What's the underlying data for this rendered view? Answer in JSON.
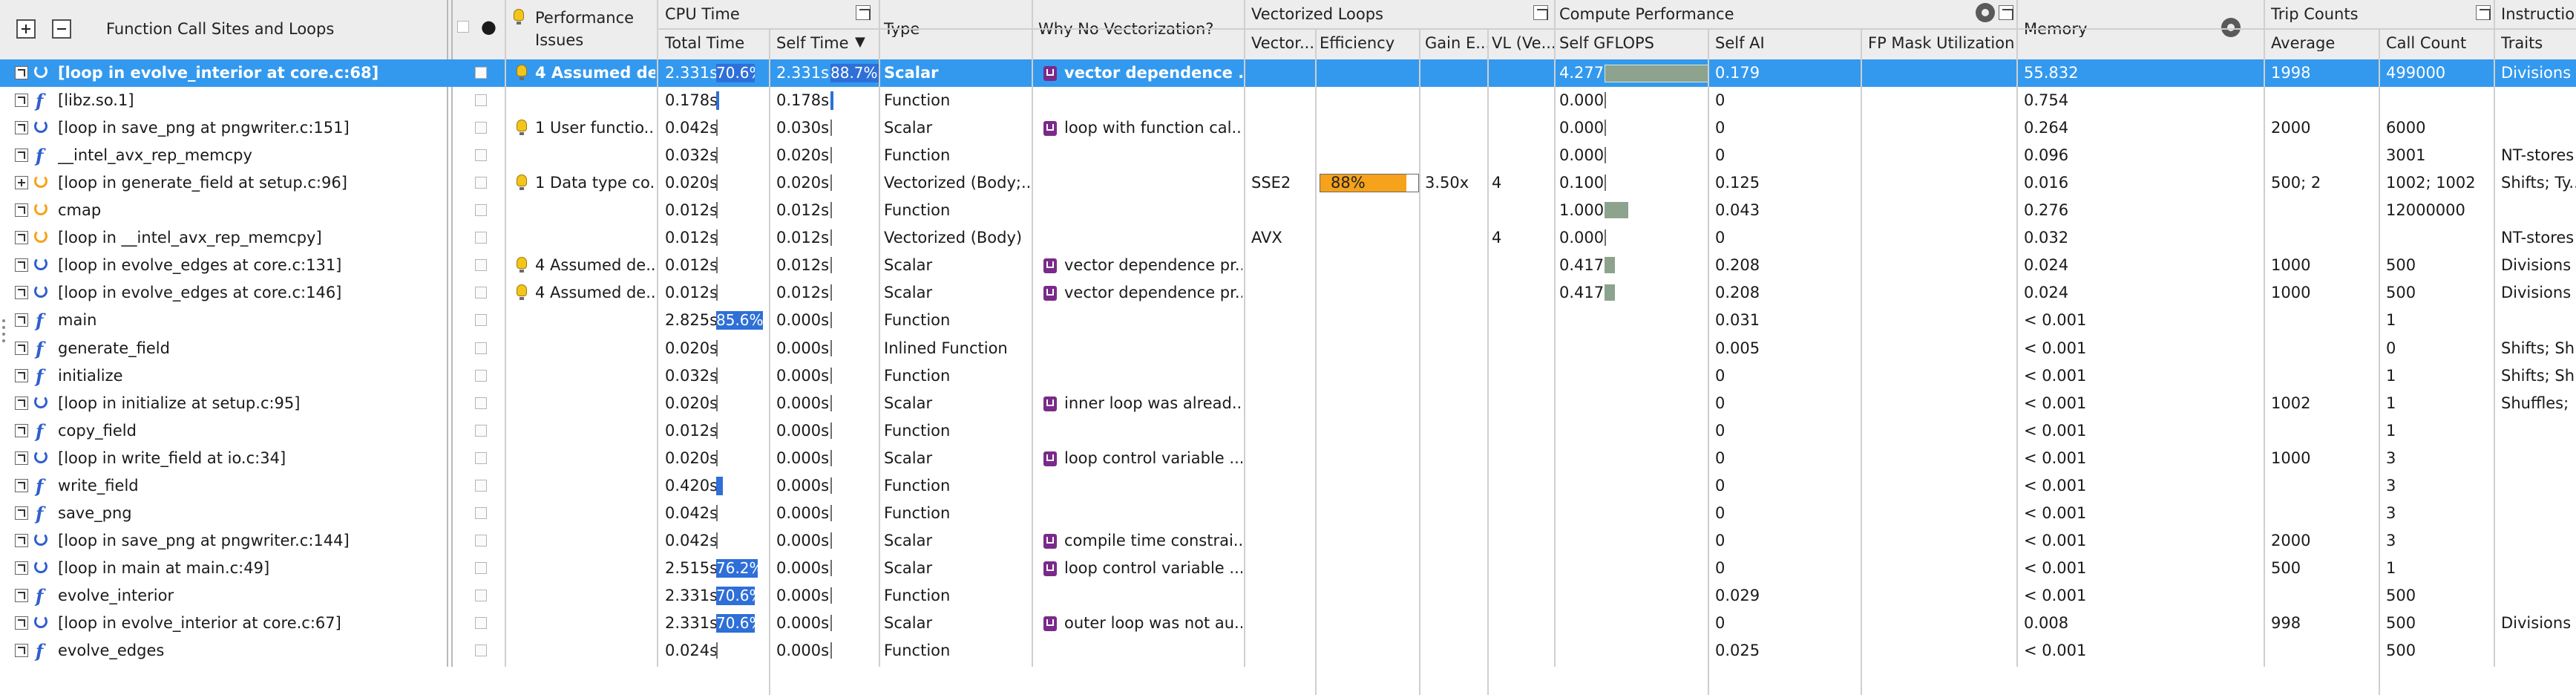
{
  "header": {
    "expand_all": "+",
    "collapse_all": "−",
    "function_col": "Function Call Sites and Loops",
    "perf_issues_1": "Performance",
    "perf_issues_2": "Issues",
    "cpu_time": "CPU Time",
    "total_time": "Total Time",
    "self_time": "Self Time",
    "type": "Type",
    "why_no_vec": "Why No Vectorization?",
    "vectorized_loops": "Vectorized Loops",
    "vectorized_col": "Vector...",
    "efficiency": "Efficiency",
    "gain": "Gain E...",
    "vl": "VL (Ve...",
    "compute_perf": "Compute Performance",
    "self_gflops": "Self GFLOPS",
    "self_ai": "Self AI",
    "fp_mask": "FP Mask Utilization",
    "memory": "Memory",
    "trip_counts": "Trip Counts",
    "average": "Average",
    "call_count": "Call Count",
    "instructions": "Instructio",
    "traits": "Traits",
    "sort_indicator": "▼",
    "expand_icon": "»"
  },
  "rows": [
    {
      "name": "[loop in evolve_interior at core.c:68]",
      "icon": "loop-icon",
      "issue": "4 Assumed de...",
      "total": "2.331s",
      "total_pct": 70.6,
      "total_label": "70.6%",
      "self": "2.331s",
      "self_pct": 88.7,
      "self_label": "88.7%",
      "type": "Scalar",
      "why": "vector dependence ...",
      "vec": "",
      "eff": "",
      "gain": "",
      "vl": "",
      "gflops": "4.277",
      "gflops_frac": 1.0,
      "ai": "0.179",
      "memory": "55.832",
      "avg": "1998",
      "calls": "499000",
      "traits": "Divisions",
      "selected": true
    },
    {
      "name": "[libz.so.1]",
      "icon": "function-icon",
      "issue": "",
      "total": "0.178s",
      "total_pct": 3,
      "self": "0.178s",
      "self_pct": 3,
      "type": "Function",
      "why": "",
      "gflops": "0.000",
      "ai": "0",
      "memory": "0.754",
      "avg": "",
      "calls": "",
      "traits": ""
    },
    {
      "name": "[loop in save_png at pngwriter.c:151]",
      "icon": "loop-icon",
      "issue": "1 User functio...",
      "total": "0.042s",
      "self": "0.030s",
      "type": "Scalar",
      "why": "loop with function cal...",
      "gflops": "0.000",
      "ai": "0",
      "memory": "0.264",
      "avg": "2000",
      "calls": "6000",
      "traits": ""
    },
    {
      "name": "__intel_avx_rep_memcpy",
      "icon": "function-icon",
      "issue": "",
      "total": "0.032s",
      "self": "0.020s",
      "type": "Function",
      "why": "",
      "gflops": "0.000",
      "ai": "0",
      "memory": "0.096",
      "avg": "",
      "calls": "3001",
      "traits": "NT-stores"
    },
    {
      "name": "[loop in generate_field at setup.c:96]",
      "icon": "loop-orange-icon",
      "issue": "1 Data type co...",
      "total": "0.020s",
      "self": "0.020s",
      "type": "Vectorized (Body;...",
      "why": "",
      "vec": "SSE2",
      "eff": "88%",
      "eff_frac": 0.88,
      "gain": "3.50x",
      "vl": "4",
      "gflops": "0.100",
      "ai": "0.125",
      "memory": "0.016",
      "avg": "500; 2",
      "calls": "1002; 1002",
      "traits": "Shifts; Ty..."
    },
    {
      "name": "cmap",
      "icon": "loop-orange-icon",
      "issue": "",
      "total": "0.012s",
      "self": "0.012s",
      "type": "Function",
      "why": "",
      "gflops": "1.000",
      "gflops_frac": 0.23,
      "ai": "0.043",
      "memory": "0.276",
      "avg": "",
      "calls": "12000000",
      "traits": ""
    },
    {
      "name": "[loop in __intel_avx_rep_memcpy]",
      "icon": "loop-orange-icon",
      "issue": "",
      "total": "0.012s",
      "self": "0.012s",
      "type": "Vectorized (Body)",
      "why": "",
      "vec": "AVX",
      "vl": "4",
      "gflops": "0.000",
      "ai": "0",
      "memory": "0.032",
      "avg": "",
      "calls": "",
      "traits": "NT-stores"
    },
    {
      "name": "[loop in evolve_edges at core.c:131]",
      "icon": "loop-icon",
      "issue": "4 Assumed de...",
      "total": "0.012s",
      "self": "0.012s",
      "type": "Scalar",
      "why": "vector dependence pr...",
      "gflops": "0.417",
      "gflops_frac": 0.1,
      "ai": "0.208",
      "memory": "0.024",
      "avg": "1000",
      "calls": "500",
      "traits": "Divisions"
    },
    {
      "name": "[loop in evolve_edges at core.c:146]",
      "icon": "loop-icon",
      "issue": "4 Assumed de...",
      "total": "0.012s",
      "self": "0.012s",
      "type": "Scalar",
      "why": "vector dependence pr...",
      "gflops": "0.417",
      "gflops_frac": 0.1,
      "ai": "0.208",
      "memory": "0.024",
      "avg": "1000",
      "calls": "500",
      "traits": "Divisions"
    },
    {
      "name": "main",
      "icon": "function-icon",
      "issue": "",
      "total": "2.825s",
      "total_pct": 85.6,
      "total_label": "85.6%",
      "self": "0.000s",
      "type": "Function",
      "why": "",
      "gflops": "",
      "ai": "0.031",
      "memory": "< 0.001",
      "avg": "",
      "calls": "1",
      "traits": ""
    },
    {
      "name": "generate_field",
      "icon": "function-icon",
      "issue": "",
      "total": "0.020s",
      "self": "0.000s",
      "type": "Inlined Function",
      "why": "",
      "gflops": "",
      "ai": "0.005",
      "memory": "< 0.001",
      "avg": "",
      "calls": "0",
      "traits": "Shifts; Sh"
    },
    {
      "name": "initialize",
      "icon": "function-icon",
      "issue": "",
      "total": "0.032s",
      "self": "0.000s",
      "type": "Function",
      "why": "",
      "gflops": "",
      "ai": "0",
      "memory": "< 0.001",
      "avg": "",
      "calls": "1",
      "traits": "Shifts; Sh"
    },
    {
      "name": "[loop in initialize at setup.c:95]",
      "icon": "loop-icon",
      "issue": "",
      "total": "0.020s",
      "self": "0.000s",
      "type": "Scalar",
      "why": "inner loop was alread...",
      "gflops": "",
      "ai": "0",
      "memory": "< 0.001",
      "avg": "1002",
      "calls": "1",
      "traits": "Shuffles;"
    },
    {
      "name": "copy_field",
      "icon": "function-icon",
      "issue": "",
      "total": "0.012s",
      "self": "0.000s",
      "type": "Function",
      "why": "",
      "gflops": "",
      "ai": "0",
      "memory": "< 0.001",
      "avg": "",
      "calls": "1",
      "traits": ""
    },
    {
      "name": "[loop in write_field at io.c:34]",
      "icon": "loop-icon",
      "issue": "",
      "total": "0.020s",
      "self": "0.000s",
      "type": "Scalar",
      "why": "loop control variable ...",
      "gflops": "",
      "ai": "0",
      "memory": "< 0.001",
      "avg": "1000",
      "calls": "3",
      "traits": ""
    },
    {
      "name": "write_field",
      "icon": "function-icon",
      "issue": "",
      "total": "0.420s",
      "total_pct": 12,
      "self": "0.000s",
      "type": "Function",
      "why": "",
      "gflops": "",
      "ai": "0",
      "memory": "< 0.001",
      "avg": "",
      "calls": "3",
      "traits": ""
    },
    {
      "name": "save_png",
      "icon": "function-icon",
      "issue": "",
      "total": "0.042s",
      "self": "0.000s",
      "type": "Function",
      "why": "",
      "gflops": "",
      "ai": "0",
      "memory": "< 0.001",
      "avg": "",
      "calls": "3",
      "traits": ""
    },
    {
      "name": "[loop in save_png at pngwriter.c:144]",
      "icon": "loop-icon",
      "issue": "",
      "total": "0.042s",
      "self": "0.000s",
      "type": "Scalar",
      "why": "compile time constrai...",
      "gflops": "",
      "ai": "0",
      "memory": "< 0.001",
      "avg": "2000",
      "calls": "3",
      "traits": ""
    },
    {
      "name": "[loop in main at main.c:49]",
      "icon": "loop-icon",
      "issue": "",
      "total": "2.515s",
      "total_pct": 76.2,
      "total_label": "76.2%",
      "self": "0.000s",
      "type": "Scalar",
      "why": "loop control variable ...",
      "gflops": "",
      "ai": "0",
      "memory": "< 0.001",
      "avg": "500",
      "calls": "1",
      "traits": ""
    },
    {
      "name": "evolve_interior",
      "icon": "function-icon",
      "issue": "",
      "total": "2.331s",
      "total_pct": 70.6,
      "total_label": "70.6%",
      "self": "0.000s",
      "type": "Function",
      "why": "",
      "gflops": "",
      "ai": "0.029",
      "memory": "< 0.001",
      "avg": "",
      "calls": "500",
      "traits": ""
    },
    {
      "name": "[loop in evolve_interior at core.c:67]",
      "icon": "loop-icon",
      "issue": "",
      "total": "2.331s",
      "total_pct": 70.6,
      "total_label": "70.6%",
      "self": "0.000s",
      "type": "Scalar",
      "why": "outer loop was not au...",
      "gflops": "",
      "ai": "0",
      "memory": "0.008",
      "avg": "998",
      "calls": "500",
      "traits": "Divisions"
    },
    {
      "name": "evolve_edges",
      "icon": "function-icon",
      "issue": "",
      "total": "0.024s",
      "self": "0.000s",
      "type": "Function",
      "why": "",
      "gflops": "",
      "ai": "0.025",
      "memory": "< 0.001",
      "avg": "",
      "calls": "500",
      "traits": ""
    }
  ],
  "colors": {
    "selection": "#3399ee",
    "bar": "#2e6fd8",
    "gflops_bar": "#8da38d",
    "efficiency": "#f6a21a",
    "why_icon": "#7a2a8a",
    "loop_icon": "#2f5fce"
  }
}
